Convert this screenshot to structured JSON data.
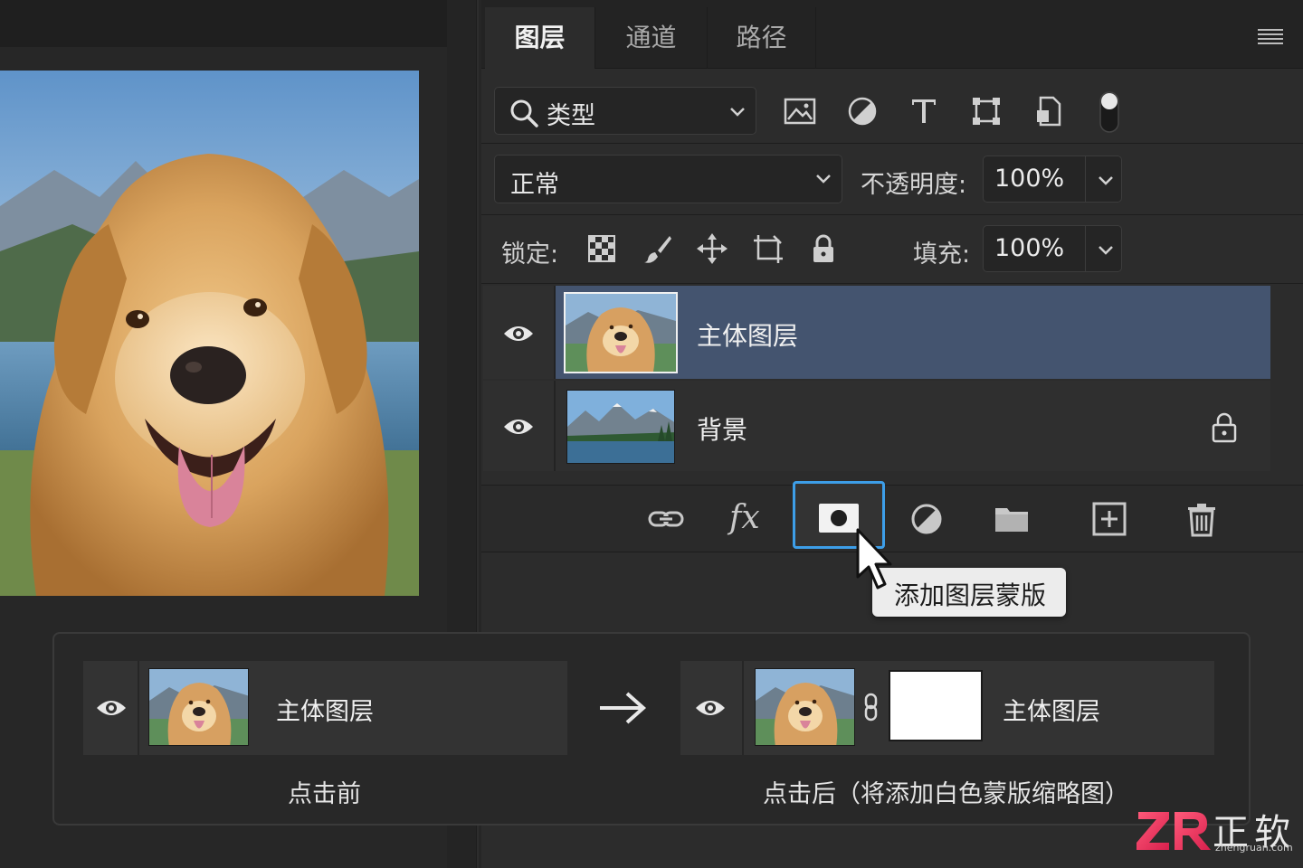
{
  "panel": {
    "tabs": [
      {
        "label": "图层",
        "active": true
      },
      {
        "label": "通道",
        "active": false
      },
      {
        "label": "路径",
        "active": false
      }
    ],
    "menu_icon": "hamburger-menu-icon"
  },
  "filter": {
    "label": "类型",
    "icons": [
      "search-icon",
      "chevron-down-icon",
      "image-filter-icon",
      "adjustment-filter-icon",
      "type-filter-icon",
      "shape-filter-icon",
      "smart-object-filter-icon",
      "filter-toggle-icon"
    ]
  },
  "blend": {
    "mode": "正常",
    "opacity_label": "不透明度:",
    "opacity_value": "100%"
  },
  "lock": {
    "label": "锁定:",
    "icons": [
      "lock-transparent-icon",
      "lock-paint-icon",
      "lock-move-icon",
      "lock-artboard-icon",
      "lock-all-icon"
    ],
    "fill_label": "填充:",
    "fill_value": "100%"
  },
  "layers": [
    {
      "name": "主体图层",
      "visible": true,
      "selected": true,
      "locked": false
    },
    {
      "name": "背景",
      "visible": true,
      "selected": false,
      "locked": true
    }
  ],
  "toolbar": {
    "fx_label": "fx",
    "buttons": [
      "link-layers-icon",
      "fx-icon",
      "add-mask-icon",
      "adjustment-layer-icon",
      "group-folder-icon",
      "new-layer-icon",
      "trash-icon"
    ],
    "tooltip": "添加图层蒙版"
  },
  "comparison": {
    "before": {
      "layer_name": "主体图层",
      "caption": "点击前"
    },
    "after": {
      "layer_name": "主体图层",
      "caption": "点击后（将添加白色蒙版缩略图）"
    }
  },
  "watermark": {
    "brand": "正软",
    "url": "zhengruan.com"
  },
  "colors": {
    "selection": "#44546f",
    "focus_ring": "#3d9ee8",
    "panel_bg": "#2c2c2c"
  }
}
